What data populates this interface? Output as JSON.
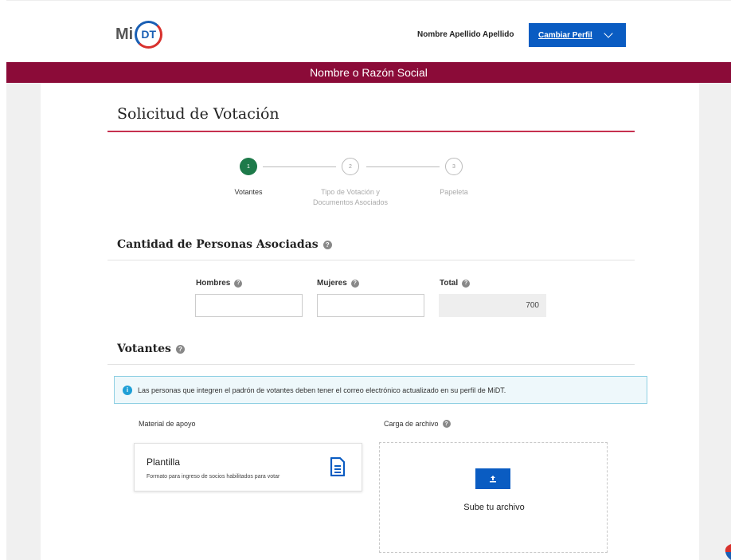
{
  "header": {
    "logo_mi": "Mi",
    "logo_dt": "DT",
    "user_name": "Nombre Apellido Apellido",
    "profile_button": "Cambiar Perfil"
  },
  "banner": "Nombre o Razón Social",
  "page_title": "Solicitud de Votación",
  "stepper": {
    "steps": [
      {
        "number": "1",
        "label": "Votantes",
        "active": true
      },
      {
        "number": "2",
        "label_line1": "Tipo de Votación y",
        "label_line2": "Documentos Asociados",
        "active": false
      },
      {
        "number": "3",
        "label": "Papeleta",
        "active": false
      }
    ]
  },
  "personas": {
    "title": "Cantidad de Personas Asociadas",
    "fields": [
      {
        "label": "Hombres",
        "value": ""
      },
      {
        "label": "Mujeres",
        "value": ""
      },
      {
        "label": "Total",
        "value": "700"
      }
    ]
  },
  "votantes": {
    "title": "Votantes",
    "info": "Las personas que integren el padrón de votantes deben tener el correo electrónico actualizado en su perfil de MiDT.",
    "material_label": "Material de apoyo",
    "carga_label": "Carga de archivo",
    "card": {
      "title": "Plantilla",
      "description": "Formato para ingreso de socios habilitados para votar"
    },
    "upload_text": "Sube tu archivo"
  },
  "colors": {
    "brand_red": "#8b0b38",
    "primary_blue": "#0a5cc2",
    "step_green": "#1e7a4a",
    "title_rule": "#c6304f"
  }
}
